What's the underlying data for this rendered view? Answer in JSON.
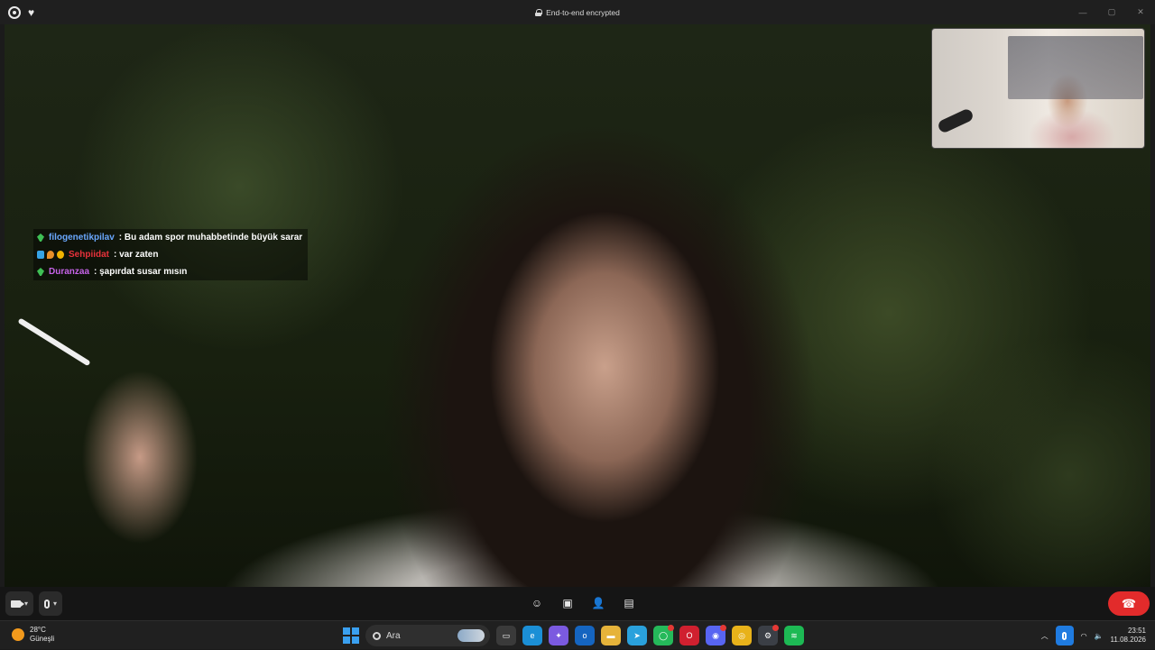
{
  "window": {
    "app_icon": "whatsapp-icon",
    "favorite_icon": "heart-icon",
    "title": "End-to-end encrypted",
    "controls": [
      "minimize-icon",
      "maximize-icon",
      "close-icon"
    ]
  },
  "video": {
    "description_icons": [
      "camera-icon"
    ],
    "chat_overlay": [
      {
        "badges": [
          "leaf"
        ],
        "user": "filogenetikpilav",
        "user_color": "#6aa8ff",
        "message": ": Bu adam spor muhabbetinde büyük sarar"
      },
      {
        "badges": [
          "cube",
          "drop",
          "coin"
        ],
        "user": "Sehpiidat",
        "user_color": "#e8323b",
        "message": ": var zaten"
      },
      {
        "badges": [
          "leaf"
        ],
        "user": "Duranzaa",
        "user_color": "#c763e9",
        "message": ": şapırdat susar mısın"
      }
    ]
  },
  "call_controls": {
    "camera_icon": "camera-icon",
    "mic_icon": "microphone-icon",
    "center_icons": [
      "emoji-icon",
      "screen-share-icon",
      "add-participant-icon",
      "captions-icon"
    ],
    "end_call_icon": "end-call-icon",
    "end_call_color": "#e22b2b"
  },
  "taskbar": {
    "weather_temp": "28°C",
    "weather_desc": "Güneşli",
    "search_placeholder": "Ara",
    "apps": [
      {
        "name": "file-explorer-app",
        "color": "#3a3a3a",
        "glyph": "▭"
      },
      {
        "name": "edge-app",
        "color": "#1b8fd6",
        "glyph": "e"
      },
      {
        "name": "copilot-app",
        "color": "#7b5ae0",
        "glyph": "✦"
      },
      {
        "name": "outlook-app",
        "color": "#1565c0",
        "glyph": "o"
      },
      {
        "name": "folder-app",
        "color": "#e6b33a",
        "glyph": "▬"
      },
      {
        "name": "telegram-app",
        "color": "#2aa1dc",
        "glyph": "➤"
      },
      {
        "name": "whatsapp-app",
        "color": "#25b95a",
        "glyph": "◯"
      },
      {
        "name": "opera-app",
        "color": "#d0202f",
        "glyph": "O"
      },
      {
        "name": "discord-app",
        "color": "#5865f2",
        "glyph": "◉"
      },
      {
        "name": "chrome-app",
        "color": "#e8b21a",
        "glyph": "◎"
      },
      {
        "name": "steam-app",
        "color": "#3b3f46",
        "glyph": "⚙"
      },
      {
        "name": "spotify-app",
        "color": "#1db954",
        "glyph": "≋"
      }
    ],
    "clock_time": "23:51",
    "clock_date": "11.08.2026",
    "accent": "#1f7be0"
  }
}
